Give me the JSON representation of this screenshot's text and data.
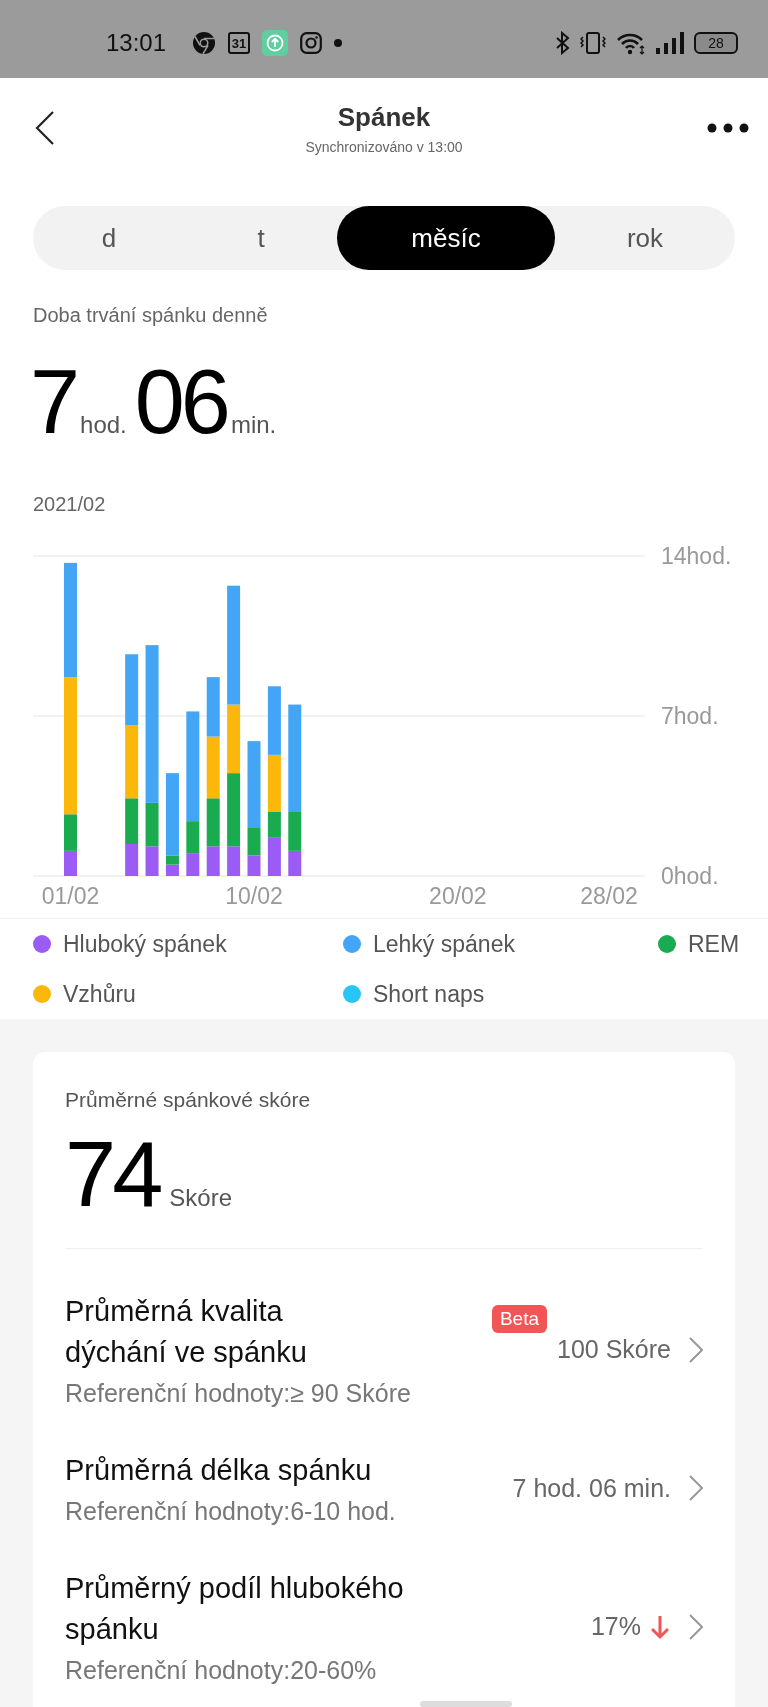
{
  "status_bar": {
    "time": "13:01",
    "calendar_day": "31",
    "battery": "28"
  },
  "header": {
    "title": "Spánek",
    "subtitle": "Synchronizováno v 13:00"
  },
  "tabs": [
    {
      "label": "d",
      "selected": false
    },
    {
      "label": "t",
      "selected": false
    },
    {
      "label": "měsíc",
      "selected": true
    },
    {
      "label": "rok",
      "selected": false
    }
  ],
  "summary": {
    "label": "Doba trvání spánku denně",
    "hours": "7",
    "hours_unit": "hod.",
    "minutes": "06",
    "minutes_unit": "min."
  },
  "chart": {
    "period": "2021/02",
    "chart_data": {
      "type": "bar",
      "stacked": true,
      "categories": [
        "01/02",
        null,
        null,
        null,
        null,
        null,
        null,
        null,
        null,
        "10/02",
        null,
        null,
        null,
        null,
        null,
        null,
        null,
        null,
        null,
        "20/02",
        null,
        null,
        null,
        null,
        null,
        null,
        null,
        "28/02"
      ],
      "series": [
        {
          "color": "#9b5cf6",
          "values": [
            1.1,
            null,
            null,
            1.4,
            1.3,
            0.5,
            1.0,
            1.3,
            1.3,
            0.9,
            1.7,
            1.1,
            null,
            null,
            null,
            null,
            null,
            null,
            null,
            null,
            null,
            null,
            null,
            null,
            null,
            null,
            null,
            null
          ]
        },
        {
          "color": "#1aab50",
          "values": [
            1.6,
            null,
            null,
            2.0,
            1.9,
            0.4,
            1.4,
            2.1,
            3.2,
            1.2,
            1.1,
            1.7,
            null,
            null,
            null,
            null,
            null,
            null,
            null,
            null,
            null,
            null,
            null,
            null,
            null,
            null,
            null,
            null
          ]
        },
        {
          "color": "#fbb70a",
          "values": [
            6.0,
            null,
            null,
            3.2,
            0,
            0,
            0,
            2.7,
            3.0,
            0,
            2.5,
            0,
            null,
            null,
            null,
            null,
            null,
            null,
            null,
            null,
            null,
            null,
            null,
            null,
            null,
            null,
            null,
            null
          ]
        },
        {
          "color": "#42a5f5",
          "values": [
            5.0,
            null,
            null,
            3.1,
            6.9,
            3.6,
            4.8,
            2.6,
            5.2,
            3.8,
            3.0,
            4.7,
            null,
            null,
            null,
            null,
            null,
            null,
            null,
            null,
            null,
            null,
            null,
            null,
            null,
            null,
            null,
            null
          ]
        }
      ],
      "ylim": [
        0,
        14
      ],
      "yticks": [
        {
          "value": 0,
          "label": "0hod."
        },
        {
          "value": 7,
          "label": "7hod."
        },
        {
          "value": 14,
          "label": "14hod."
        }
      ]
    }
  },
  "legend": [
    {
      "label": "Hluboký spánek",
      "color": "#9b5cf6"
    },
    {
      "label": "Lehký spánek",
      "color": "#42a5f5"
    },
    {
      "label": "REM",
      "color": "#1aab50"
    },
    {
      "label": "Vzhůru",
      "color": "#fbb70a"
    },
    {
      "label": "Short naps",
      "color": "#29c5f6"
    }
  ],
  "score_card": {
    "label": "Průměrné spánkové skóre",
    "score": "74",
    "unit": "Skóre",
    "rows": [
      {
        "title": "Průměrná kvalita dýchání ve spánku",
        "badge": "Beta",
        "value": "100 Skóre",
        "reference": "Referenční hodnoty:≥ 90 Skóre"
      },
      {
        "title": "Průměrná délka spánku",
        "value": "7 hod. 06 min.",
        "reference": "Referenční hodnoty:6-10 hod."
      },
      {
        "title": "Průměrný podíl hlubokého spánku",
        "value": "17%",
        "falling": true,
        "reference": "Referenční hodnoty:20-60%"
      }
    ]
  }
}
